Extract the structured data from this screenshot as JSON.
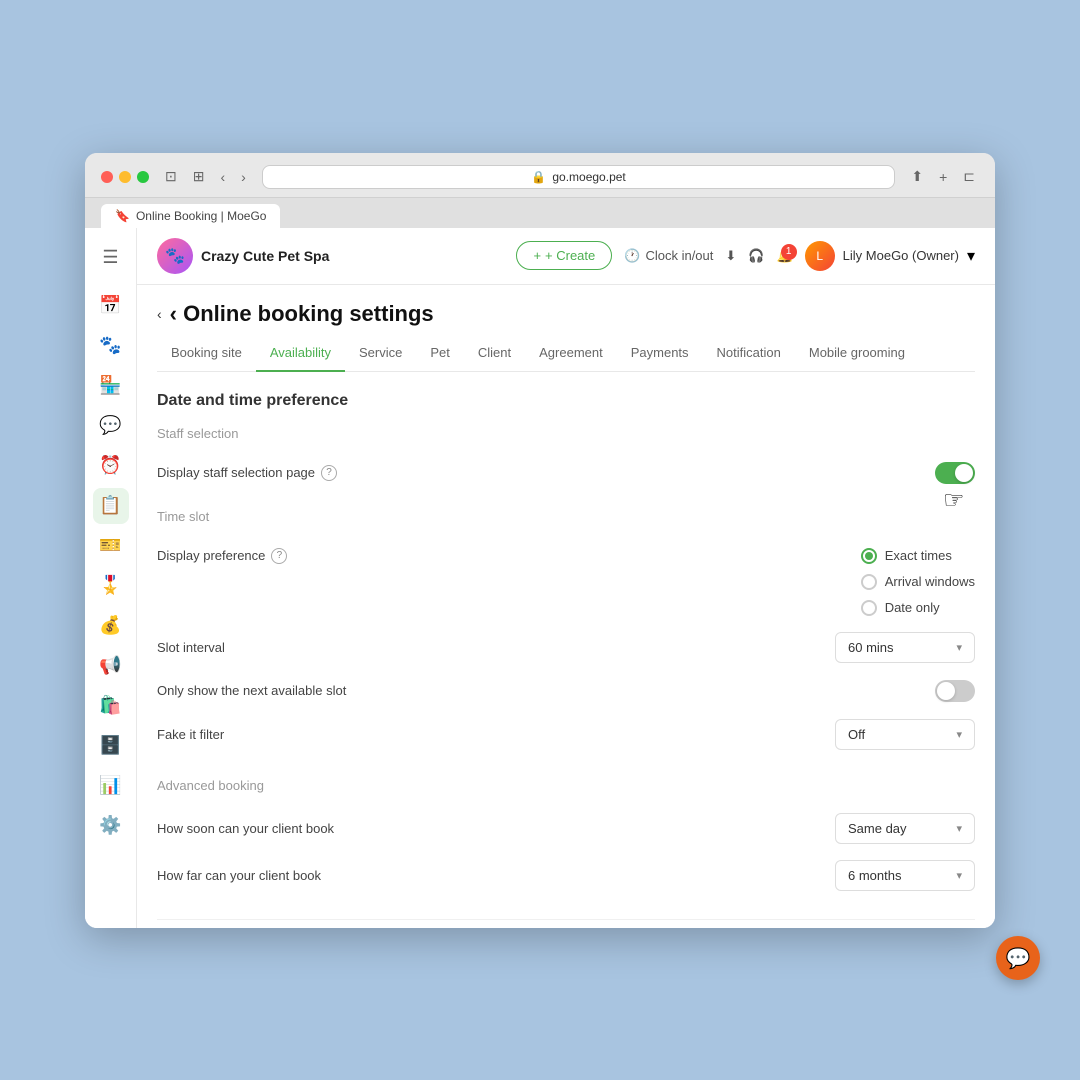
{
  "browser": {
    "url": "go.moego.pet",
    "tab_label": "Online Booking | MoeGo",
    "tab_icon": "🔖"
  },
  "app": {
    "brand_name": "Crazy Cute Pet Spa",
    "create_button": "+ Create",
    "clock_in_label": "Clock in/out",
    "user_name": "Lily MoeGo (Owner)",
    "notification_count": "1"
  },
  "page": {
    "back_label": "‹ Online booking settings",
    "tabs": [
      {
        "id": "booking-site",
        "label": "Booking site",
        "active": false
      },
      {
        "id": "availability",
        "label": "Availability",
        "active": true
      },
      {
        "id": "service",
        "label": "Service",
        "active": false
      },
      {
        "id": "pet",
        "label": "Pet",
        "active": false
      },
      {
        "id": "client",
        "label": "Client",
        "active": false
      },
      {
        "id": "agreement",
        "label": "Agreement",
        "active": false
      },
      {
        "id": "payments",
        "label": "Payments",
        "active": false
      },
      {
        "id": "notification",
        "label": "Notification",
        "active": false
      },
      {
        "id": "mobile-grooming",
        "label": "Mobile grooming",
        "active": false
      }
    ]
  },
  "sections": {
    "date_time": {
      "title": "Date and time preference",
      "staff_selection": {
        "section_label": "Staff selection",
        "display_staff_label": "Display staff selection page",
        "toggle_state": "on"
      },
      "time_slot": {
        "section_label": "Time slot",
        "display_pref_label": "Display preference",
        "radio_options": [
          {
            "id": "exact",
            "label": "Exact times",
            "selected": true
          },
          {
            "id": "arrival",
            "label": "Arrival windows",
            "selected": false
          },
          {
            "id": "date-only",
            "label": "Date only",
            "selected": false
          }
        ],
        "slot_interval_label": "Slot interval",
        "slot_interval_value": "60 mins",
        "next_available_label": "Only show the next available slot",
        "next_available_toggle": "off",
        "fake_it_label": "Fake it filter",
        "fake_it_value": "Off"
      },
      "advanced_booking": {
        "section_label": "Advanced booking",
        "how_soon_label": "How soon can your client book",
        "how_soon_value": "Same day",
        "how_far_label": "How far can your client book",
        "how_far_value": "6 months"
      }
    }
  },
  "sidebar": {
    "items": [
      {
        "id": "menu",
        "icon": "☰",
        "label": "Menu"
      },
      {
        "id": "calendar",
        "icon": "📅",
        "label": "Calendar"
      },
      {
        "id": "clients",
        "icon": "🐾",
        "label": "Clients"
      },
      {
        "id": "inventory",
        "icon": "🏪",
        "label": "Inventory"
      },
      {
        "id": "messages",
        "icon": "💬",
        "label": "Messages"
      },
      {
        "id": "reminders",
        "icon": "⏰",
        "label": "Reminders"
      },
      {
        "id": "booking",
        "icon": "📋",
        "label": "Online Booking",
        "active": true
      },
      {
        "id": "tickets",
        "icon": "🎫",
        "label": "Tickets"
      },
      {
        "id": "loyalty",
        "icon": "🎖️",
        "label": "Loyalty"
      },
      {
        "id": "payments",
        "icon": "💰",
        "label": "Payments"
      },
      {
        "id": "campaigns",
        "icon": "📢",
        "label": "Campaigns"
      },
      {
        "id": "store",
        "icon": "🛍️",
        "label": "Store"
      },
      {
        "id": "vault",
        "icon": "🗄️",
        "label": "Vault"
      },
      {
        "id": "reports",
        "icon": "📊",
        "label": "Reports"
      },
      {
        "id": "settings",
        "icon": "⚙️",
        "label": "Settings"
      }
    ]
  },
  "chat": {
    "icon": "💬"
  }
}
